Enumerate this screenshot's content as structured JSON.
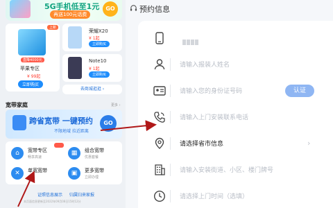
{
  "left": {
    "banner": {
      "title": "5G手机低至1元",
      "sub": "再送100元话费",
      "go": "GO"
    },
    "featured": {
      "tag": "上新",
      "sub_tag": "直降4000元",
      "name": "苹果专区",
      "price": "¥ 99起",
      "button": "立即购买"
    },
    "products": [
      {
        "name": "荣耀X20",
        "price": "¥ 1起",
        "button": "立即购买",
        "color": "#b7d8f7"
      },
      {
        "name": "Note10",
        "price": "¥ 1起",
        "button": "立即购买",
        "color": "#3b3b55"
      }
    ],
    "more_shop": "去商城逛逛 ›",
    "section_title": "宽带家庭",
    "section_more": "更多 ›",
    "bb_banner": {
      "title": "跨省宽带 一键预约",
      "sub": "不限地域 拉近距离",
      "go": "GO"
    },
    "grid": [
      {
        "title": "宽带专区",
        "sub": "畅享高速",
        "icon": "house-icon",
        "color": "#2d8cf0",
        "badge": true
      },
      {
        "title": "组合宽带",
        "sub": "优惠套餐",
        "icon": "bundle-icon",
        "color": "#2d8cf0",
        "badge": false
      },
      {
        "title": "单宽宽带",
        "sub": "月付",
        "icon": "tools-icon",
        "color": "#2d8cf0",
        "badge": false
      },
      {
        "title": "更多宽带",
        "sub": "立即办理",
        "icon": "grid-icon",
        "color": "#2d8cf0",
        "badge": false
      }
    ],
    "links": [
      "证照信息展示",
      "归属归来家报"
    ],
    "footer": "本页面信息更新至2022年09月08日15时12分"
  },
  "right": {
    "header": "预约信息",
    "rows": [
      {
        "kind": "masked",
        "icon": "phone-icon"
      },
      {
        "kind": "input",
        "icon": "user-icon",
        "placeholder": "请输入报装人姓名"
      },
      {
        "kind": "input",
        "icon": "id-card-icon",
        "placeholder": "请输入您的身份证号码",
        "button": "认证"
      },
      {
        "kind": "input",
        "icon": "call-icon",
        "placeholder": "请输入上门安装联系电话"
      },
      {
        "kind": "select",
        "icon": "location-icon",
        "value": "请选择省市信息"
      },
      {
        "kind": "input",
        "icon": "building-icon",
        "placeholder": "请输入安装街道、小区、楼门牌号"
      },
      {
        "kind": "input",
        "icon": "clock-icon",
        "placeholder": "请选择上门时间（选填）"
      }
    ]
  },
  "colors": {
    "accent": "#1e8dfc",
    "auth": "#8fb6f3",
    "arrow": "#b01818"
  }
}
